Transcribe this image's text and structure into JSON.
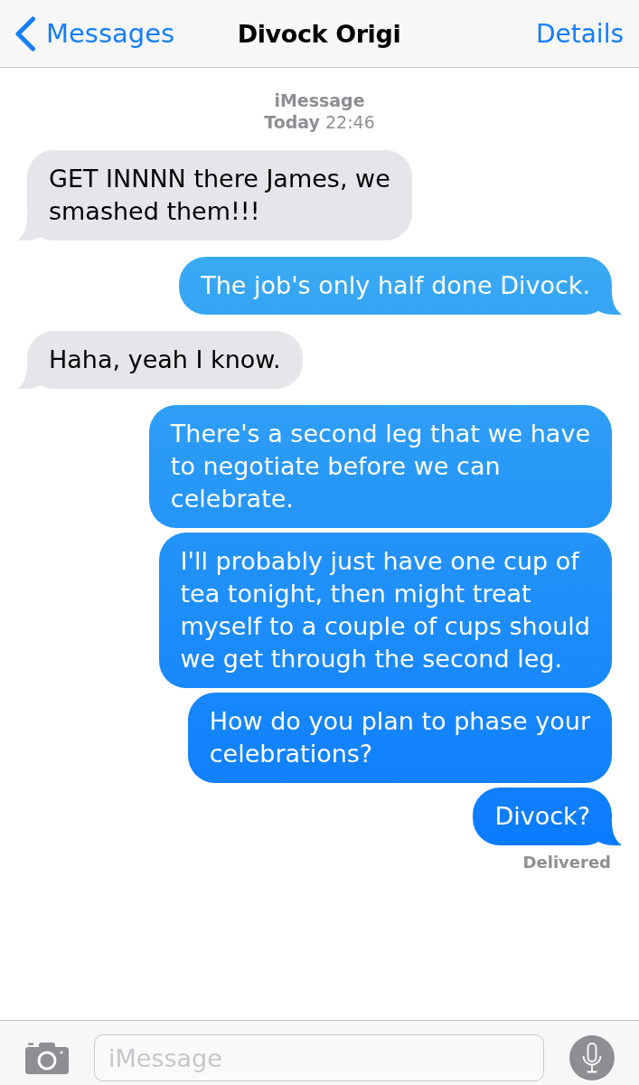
{
  "nav_bar": {
    "back_label": "Messages",
    "title": "Divock Origi",
    "action_label": "Details"
  },
  "timestamp": {
    "service": "iMessage",
    "date_line": "**Today** 22:46"
  },
  "messages": [
    {
      "kind": "received",
      "text": "GET INNNN there James, we\nsmashed them!!!"
    },
    {
      "kind": "sent",
      "text": "The job's only half done Divock."
    },
    {
      "kind": "received",
      "text": "Haha, yeah I know."
    },
    {
      "kind": "sent",
      "text": "There's a second leg that we have\nto negotiate before we can\ncelebrate."
    },
    {
      "kind": "sent",
      "text": "I'll probably just have one cup of\ntea tonight, then might treat\nmyself to a couple of cups should\nwe get through the second leg."
    },
    {
      "kind": "sent",
      "text": "How do you plan to phase your\ncelebrations?"
    },
    {
      "kind": "sent",
      "text": "Divock?"
    }
  ],
  "receipt": "Delivered",
  "input_bar": {
    "placeholder": "iMessage"
  }
}
